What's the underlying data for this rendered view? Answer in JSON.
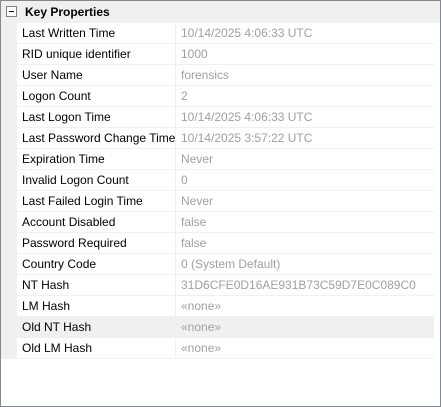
{
  "category": {
    "title": "Key Properties",
    "expanded": true
  },
  "properties": [
    {
      "name": "Last Written Time",
      "value": "10/14/2025 4:06:33 UTC"
    },
    {
      "name": "RID unique identifier",
      "value": "1000"
    },
    {
      "name": "User Name",
      "value": "forensics"
    },
    {
      "name": "Logon Count",
      "value": "2"
    },
    {
      "name": "Last Logon Time",
      "value": "10/14/2025 4:06:33 UTC"
    },
    {
      "name": "Last Password Change Time",
      "value": "10/14/2025 3:57:22 UTC"
    },
    {
      "name": "Expiration Time",
      "value": "Never"
    },
    {
      "name": "Invalid Logon Count",
      "value": "0"
    },
    {
      "name": "Last Failed Login Time",
      "value": "Never"
    },
    {
      "name": "Account Disabled",
      "value": "false"
    },
    {
      "name": "Password Required",
      "value": "false"
    },
    {
      "name": "Country Code",
      "value": "0 (System Default)"
    },
    {
      "name": "NT Hash",
      "value": "31D6CFE0D16AE931B73C59D7E0C089C0"
    },
    {
      "name": "LM Hash",
      "value": "«none»"
    },
    {
      "name": "Old NT Hash",
      "value": "«none»"
    },
    {
      "name": "Old LM Hash",
      "value": "«none»"
    }
  ],
  "selected_row": "Old NT Hash",
  "colors": {
    "border": "#828790",
    "category_bg": "#f0f0f0",
    "value_text": "#a0a0a0",
    "selected_bg": "#f0f0f0"
  }
}
